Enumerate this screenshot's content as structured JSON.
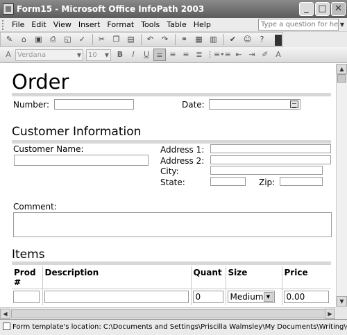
{
  "window": {
    "title": "Form15 - Microsoft Office InfoPath 2003",
    "minimize_glyph": "_",
    "maximize_glyph": "□",
    "close_glyph": "✕"
  },
  "menubar": {
    "items": [
      {
        "label": "File"
      },
      {
        "label": "Edit"
      },
      {
        "label": "View"
      },
      {
        "label": "Insert"
      },
      {
        "label": "Format"
      },
      {
        "label": "Tools"
      },
      {
        "label": "Table"
      },
      {
        "label": "Help"
      }
    ],
    "help_placeholder": "Type a question for help"
  },
  "toolbar": {
    "icons": [
      "design-icon",
      "open-icon",
      "save-icon",
      "print-icon",
      "print-preview-icon",
      "spelling-icon",
      "cut-icon",
      "copy-icon",
      "paste-icon",
      "undo-icon",
      "redo-icon",
      "hyperlink-icon",
      "table-icon",
      "views-icon",
      "submit-icon",
      "digital-signature-icon",
      "help-icon"
    ]
  },
  "format_toolbar": {
    "font": "Verdana",
    "size": "10",
    "bold": "B",
    "italic": "I",
    "underline": "U",
    "icons": [
      "align-left-icon",
      "align-center-icon",
      "align-right-icon",
      "justify-icon",
      "numbering-icon",
      "bullets-icon",
      "decrease-indent-icon",
      "increase-indent-icon",
      "highlight-icon",
      "font-color-icon"
    ]
  },
  "form": {
    "title": "Order",
    "number_label": "Number:",
    "date_label": "Date:",
    "customer_section": "Customer Information",
    "customer_name_label": "Customer Name:",
    "address1_label": "Address 1:",
    "address2_label": "Address 2:",
    "city_label": "City:",
    "state_label": "State:",
    "zip_label": "Zip:",
    "comment_label": "Comment:",
    "items_section": "Items",
    "items_table": {
      "headers": [
        "Prod #",
        "Description",
        "Quant",
        "Size",
        "Price"
      ],
      "row": {
        "prod": "",
        "description": "",
        "quant": "0",
        "size": "Medium",
        "price": "0.00"
      }
    }
  },
  "statusbar": {
    "text": "Form template's location: C:\\Documents and Settings\\Priscilla Walmsley\\My Documents\\Writing\\Office XML\\f"
  },
  "colors": {
    "titlebar": "#6e6e6e",
    "section_rule": "#d7d7d7"
  }
}
